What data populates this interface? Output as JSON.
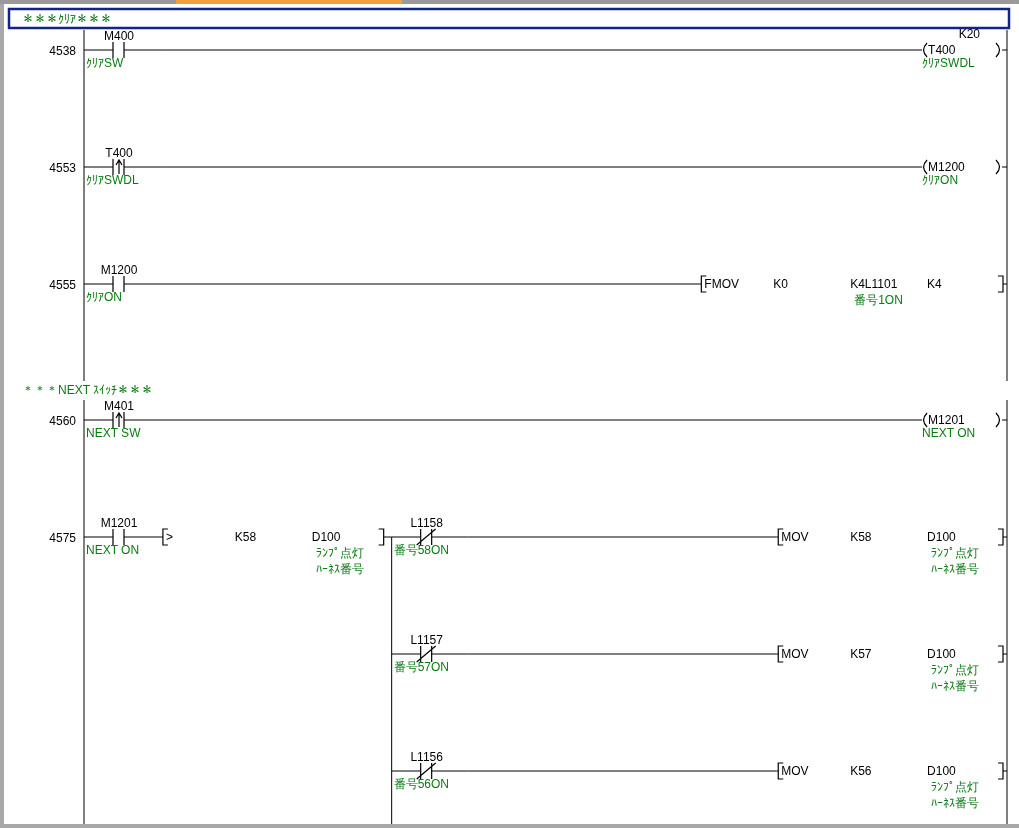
{
  "rows": [
    {
      "kind": "comment",
      "text": "＊＊＊ｸﾘｱ＊＊＊",
      "selected": true
    },
    {
      "kind": "rung",
      "step": "4538",
      "selected": false,
      "series": [
        {
          "kind": "open",
          "device": "M400",
          "comment": "ｸﾘｱSW"
        }
      ],
      "branches": [
        {
          "output": {
            "kind": "coil",
            "device": "T400",
            "setting": "K20",
            "comment": "ｸﾘｱSWDL"
          }
        }
      ]
    },
    {
      "kind": "rung",
      "step": "4553",
      "selected": false,
      "series": [
        {
          "kind": "rising",
          "device": "T400",
          "comment": "ｸﾘｱSWDL"
        }
      ],
      "branches": [
        {
          "output": {
            "kind": "coil",
            "device": "M1200",
            "comment": "ｸﾘｱON"
          }
        }
      ]
    },
    {
      "kind": "rung",
      "step": "4555",
      "selected": false,
      "series": [
        {
          "kind": "open",
          "device": "M1200",
          "comment": "ｸﾘｱON"
        }
      ],
      "branches": [
        {
          "output": {
            "kind": "instruction",
            "mnemonic": "FMOV",
            "operands": [
              {
                "text": "K0"
              },
              {
                "text": "K4L1101",
                "comment_lines": [
                  "番号1ON"
                ]
              },
              {
                "text": "K4"
              }
            ]
          }
        }
      ]
    },
    {
      "kind": "comment",
      "text": "＊＊＊NEXT ｽｲｯﾁ＊＊＊",
      "selected": false
    },
    {
      "kind": "rung",
      "step": "4560",
      "selected": false,
      "series": [
        {
          "kind": "rising",
          "device": "M401",
          "comment": "NEXT SW"
        }
      ],
      "branches": [
        {
          "output": {
            "kind": "coil",
            "device": "M1201",
            "comment": "NEXT ON"
          }
        }
      ]
    },
    {
      "kind": "rung",
      "step": "4575",
      "selected": false,
      "series": [
        {
          "kind": "open",
          "device": "M1201",
          "comment": "NEXT ON"
        },
        {
          "kind": "compare",
          "mnemonic": ">",
          "operands": [
            {
              "text": "K58"
            },
            {
              "text": "D100",
              "comment_lines": [
                "ﾗﾝﾌﾟ点灯",
                "ﾊｰﾈｽ番号"
              ]
            }
          ]
        }
      ],
      "branches": [
        {
          "contacts": [
            {
              "kind": "closed",
              "device": "L1158",
              "comment": "番号58ON"
            }
          ],
          "output": {
            "kind": "instruction",
            "mnemonic": "MOV",
            "operands": [
              {
                "text": "K58"
              },
              {
                "text": "D100",
                "comment_lines": [
                  "ﾗﾝﾌﾟ点灯",
                  "ﾊｰﾈｽ番号"
                ]
              }
            ]
          }
        },
        {
          "contacts": [
            {
              "kind": "closed",
              "device": "L1157",
              "comment": "番号57ON"
            }
          ],
          "output": {
            "kind": "instruction",
            "mnemonic": "MOV",
            "operands": [
              {
                "text": "K57"
              },
              {
                "text": "D100",
                "comment_lines": [
                  "ﾗﾝﾌﾟ点灯",
                  "ﾊｰﾈｽ番号"
                ]
              }
            ]
          }
        },
        {
          "contacts": [
            {
              "kind": "closed",
              "device": "L1156",
              "comment": "番号56ON"
            }
          ],
          "output": {
            "kind": "instruction",
            "mnemonic": "MOV",
            "operands": [
              {
                "text": "K56"
              },
              {
                "text": "D100",
                "comment_lines": [
                  "ﾗﾝﾌﾟ点灯",
                  "ﾊｰﾈｽ番号"
                ]
              }
            ]
          }
        }
      ]
    }
  ]
}
